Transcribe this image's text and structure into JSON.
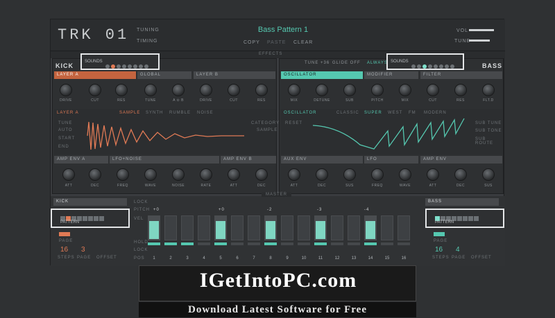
{
  "header": {
    "logo": "TRK 01",
    "tuning": "TUNING",
    "timing": "TIMING",
    "title": "Bass Pattern 1",
    "copy": "COPY",
    "paste": "PASTE",
    "clear": "CLEAR",
    "vol": "VOL",
    "tune": "TUNE"
  },
  "effects_label": "EFFECTS",
  "kick": {
    "name": "KICK",
    "sounds_label": "SOUNDS",
    "layer_a": "LAYER A",
    "global": "GLOBAL",
    "layer_b": "LAYER B",
    "knobs_a": [
      "DRIVE",
      "CUT",
      "RES"
    ],
    "knobs_global": [
      "TUNE",
      "A ⊙ B"
    ],
    "knobs_b": [
      "DRIVE",
      "CUT",
      "RES"
    ],
    "wave_label": "LAYER A",
    "wave_tabs": [
      "SAMPLE",
      "SYNTH",
      "RUMBLE",
      "NOISE"
    ],
    "wave_side": [
      "TUNE",
      "AUTO",
      "START",
      "END"
    ],
    "wave_right": [
      "CATEGORY",
      "SAMPLE"
    ],
    "env_a": "AMP ENV A",
    "lfo": "LFO+NOISE",
    "env_b": "AMP ENV B",
    "env_knobs": [
      "ATT",
      "DEC",
      "FREQ",
      "WAVE",
      "NOISE",
      "RATE",
      "ATT",
      "DEC"
    ]
  },
  "bass": {
    "name": "BASS",
    "sounds_label": "SOUNDS",
    "tune": "TUNE +36",
    "glide": "GLIDE OFF",
    "always": "ALWAYS",
    "osc": "OSCILLATOR",
    "modifier": "MODIFIER",
    "filter": "FILTER",
    "knobs_osc": [
      "MIX",
      "DETUNE",
      "SUB"
    ],
    "knobs_mod": [
      "PITCH",
      "MIX"
    ],
    "knobs_filter": [
      "CUT",
      "RES",
      "FLT.D"
    ],
    "wave_label": "OSCILLATOR",
    "wave_tabs": [
      "CLASSIC",
      "SUPER",
      "WEST",
      "FM",
      "MODERN"
    ],
    "wave_side": [
      "RESET"
    ],
    "wave_right": [
      "SUB TUNE",
      "SUB TONE",
      "SUB ROUTE"
    ],
    "aux": "AUX ENV",
    "lfo": "LFO",
    "amp": "AMP ENV",
    "env_knobs": [
      "ATT",
      "DEC",
      "SUS",
      "FREQ",
      "WAVE",
      "ATT",
      "DEC",
      "SUS"
    ]
  },
  "master": {
    "label": "MASTER",
    "kick_lane": "KICK",
    "bass_lane": "BASS",
    "pattern": "PATTERN",
    "page": "PAGE",
    "steps": "STEPS",
    "page2": "PAGE",
    "offset": "OFFSET",
    "kick_steps": "16",
    "kick_page": "3",
    "bass_steps": "16",
    "bass_page": "4",
    "rows": [
      "LOCK",
      "PITCH",
      "VEL",
      "HOLD",
      "LOCK",
      "POS"
    ],
    "pitch_marks": [
      "+0",
      "+0",
      "-2",
      "-3",
      "-4"
    ],
    "positions": [
      "1",
      "2",
      "3",
      "4",
      "5",
      "6",
      "7",
      "8",
      "9",
      "10",
      "11",
      "12",
      "13",
      "14",
      "15",
      "16"
    ],
    "velocity": [
      1,
      0,
      0,
      0,
      1,
      0,
      0,
      1,
      0,
      0,
      1,
      0,
      0,
      1,
      0,
      0
    ]
  },
  "banner": {
    "text": "IGetIntoPC.com",
    "sub": "Download Latest Software for Free"
  },
  "colors": {
    "accent_teal": "#55c8b0",
    "accent_orange": "#e07a55"
  }
}
